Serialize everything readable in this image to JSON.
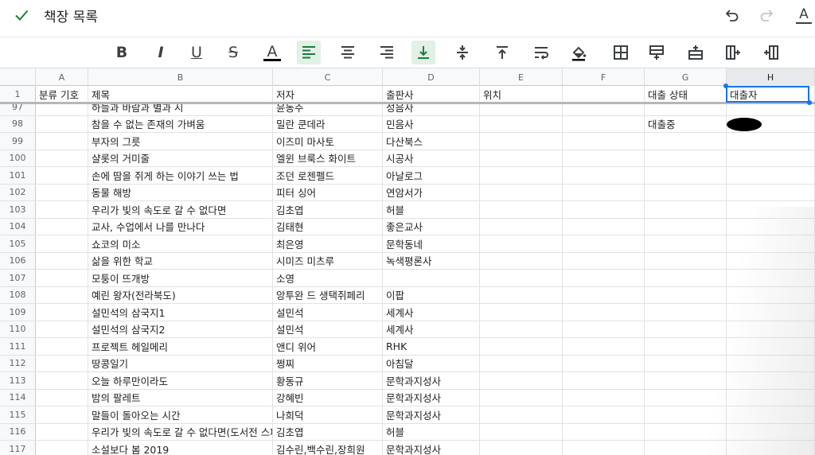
{
  "header": {
    "title": "책장 목록"
  },
  "toolbar": {
    "text_color_label": "A",
    "items": [
      "bold",
      "italic",
      "underline",
      "strikethrough",
      "text-color",
      "align-left",
      "align-center",
      "align-right",
      "valign-bottom",
      "valign-middle",
      "valign-top",
      "wrap",
      "fill-color",
      "borders",
      "insert-row-above",
      "insert-row-below",
      "insert-col-left",
      "insert-col-right"
    ]
  },
  "format_icon_label": "A",
  "columns": [
    "A",
    "B",
    "C",
    "D",
    "E",
    "F",
    "G",
    "H"
  ],
  "header_row": {
    "num": "1",
    "cells": [
      "분류 기호",
      "제목",
      "저자",
      "출판사",
      "위치",
      "",
      "대출 상태",
      "대출자"
    ]
  },
  "rows": [
    {
      "num": "97",
      "title": "하늘과 바람과 별과 시",
      "author": "윤동주",
      "publisher": "성음사",
      "status": ""
    },
    {
      "num": "98",
      "title": "참을 수 없는 존재의 가벼움",
      "author": "밀란 쿤데라",
      "publisher": "민음사",
      "status": "대출중"
    },
    {
      "num": "99",
      "title": "부자의 그릇",
      "author": "이즈미 마사토",
      "publisher": "다산북스",
      "status": ""
    },
    {
      "num": "100",
      "title": "샬롯의 거미줄",
      "author": "엘윈 브룩스 화이트",
      "publisher": "시공사",
      "status": ""
    },
    {
      "num": "101",
      "title": "손에 땀을 쥐게 하는 이야기 쓰는 법",
      "author": "조던 로젠펠드",
      "publisher": "아날로그",
      "status": ""
    },
    {
      "num": "102",
      "title": "동물 해방",
      "author": "피터 싱어",
      "publisher": "연암서가",
      "status": ""
    },
    {
      "num": "103",
      "title": "우리가 빛의 속도로 갈 수 없다면",
      "author": "김초엽",
      "publisher": "허블",
      "status": ""
    },
    {
      "num": "104",
      "title": "교사, 수업에서 나를 만나다",
      "author": "김태현",
      "publisher": "좋은교사",
      "status": ""
    },
    {
      "num": "105",
      "title": "쇼코의 미소",
      "author": "최은영",
      "publisher": "문학동네",
      "status": ""
    },
    {
      "num": "106",
      "title": "삶을 위한 학교",
      "author": "시미즈 미츠루",
      "publisher": "녹색평론사",
      "status": ""
    },
    {
      "num": "107",
      "title": "모퉁이 뜨개방",
      "author": "소영",
      "publisher": "",
      "status": ""
    },
    {
      "num": "108",
      "title": "예린 왕자(전라북도)",
      "author": "앙투완 드 생택쥐페리",
      "publisher": "이팝",
      "status": ""
    },
    {
      "num": "109",
      "title": "설민석의 삼국지1",
      "author": "설민석",
      "publisher": "세계사",
      "status": ""
    },
    {
      "num": "110",
      "title": "설민석의 삼국지2",
      "author": "설민석",
      "publisher": "세계사",
      "status": ""
    },
    {
      "num": "111",
      "title": "프로젝트 헤일메리",
      "author": "앤디 위어",
      "publisher": "RHK",
      "status": ""
    },
    {
      "num": "112",
      "title": "땅콩일기",
      "author": "쩡찌",
      "publisher": "아침달",
      "status": ""
    },
    {
      "num": "113",
      "title": "오늘 하루만이라도",
      "author": "황동규",
      "publisher": "문학과지성사",
      "status": ""
    },
    {
      "num": "114",
      "title": "밤의 팔레트",
      "author": "강혜빈",
      "publisher": "문학과지성사",
      "status": ""
    },
    {
      "num": "115",
      "title": "말들이 돌아오는 시간",
      "author": "나희덕",
      "publisher": "문학과지성사",
      "status": ""
    },
    {
      "num": "116",
      "title": "우리가 빛의 속도로 갈 수 없다면(도서전 스페",
      "author": "김초엽",
      "publisher": "허블",
      "status": ""
    },
    {
      "num": "117",
      "title": "소설보다 봄 2019",
      "author": "김수린,백수린,장희원",
      "publisher": "문학과지성사",
      "status": ""
    }
  ]
}
